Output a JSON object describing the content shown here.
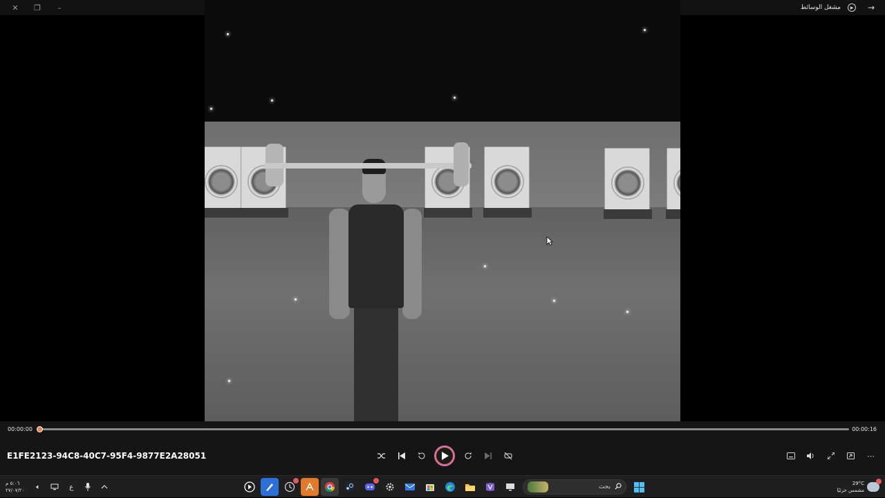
{
  "window": {
    "title": "مشغل الوسائط",
    "controls": [
      "close-icon",
      "restore-icon",
      "minimize-icon"
    ]
  },
  "player": {
    "current_time": "00:00:00",
    "total_time": "00:00:16",
    "progress_fraction": 0.0,
    "file_name": "E1FE2123-94C8-40C7-95F4-9877E2A28051",
    "accent_color": "#e8834a",
    "transport": [
      "shuffle-icon",
      "previous-icon",
      "rewind-10-icon",
      "play-icon",
      "forward-30-icon",
      "next-icon",
      "repeat-off-icon"
    ],
    "tools": [
      "captions-icon",
      "volume-icon",
      "fullscreen-icon",
      "mini-player-icon",
      "more-icon"
    ]
  },
  "taskbar": {
    "clock_time": "٥:٠٦ م",
    "clock_date": "٢٧/٠٧/٢٠",
    "language": "ع",
    "search_placeholder": "بحث",
    "weather_temp": "29°C",
    "weather_desc": "مشمس جزئيًا",
    "apps": [
      "media-player-icon",
      "paint-icon",
      "clock-icon",
      "app-a-icon",
      "chrome-icon",
      "steam-icon",
      "discord-icon",
      "settings-icon",
      "mail-icon",
      "store-icon",
      "edge-icon",
      "file-explorer-icon",
      "office-icon",
      "desktop-icon"
    ]
  }
}
